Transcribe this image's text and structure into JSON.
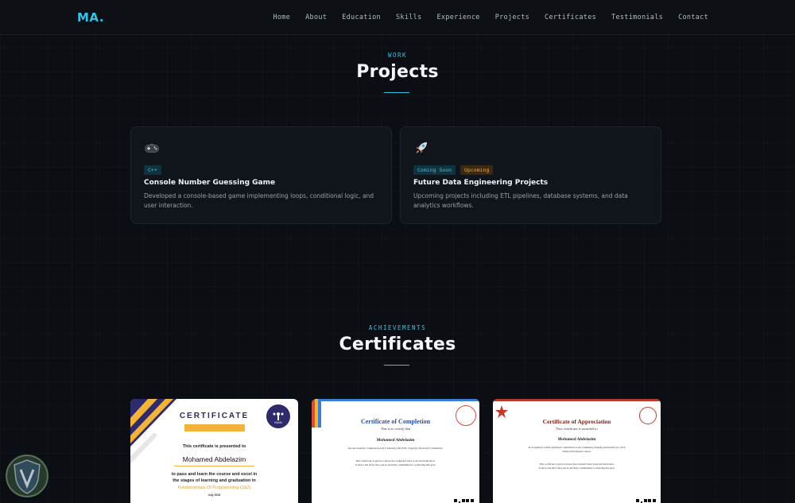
{
  "nav": {
    "logo": "MA.",
    "links": [
      "Home",
      "About",
      "Education",
      "Skills",
      "Experience",
      "Projects",
      "Certificates",
      "Testimonials",
      "Contact"
    ]
  },
  "projects_section": {
    "eyebrow": "WORK",
    "title": "Projects",
    "cards": [
      {
        "icon": "gamepad-icon",
        "tags": [
          "C++"
        ],
        "title": "Console Number Guessing Game",
        "description": "Developed a console-based game implementing loops, conditional logic, and user interaction."
      },
      {
        "icon": "rocket-icon",
        "tags": [
          "Coming Soon",
          "Upcoming"
        ],
        "title": "Future Data Engineering Projects",
        "description": "Upcoming projects including ETL pipelines, database systems, and data analytics workflows."
      }
    ]
  },
  "certificates_section": {
    "eyebrow": "ACHIEVEMENTS",
    "title": "Certificates",
    "certs": [
      {
        "heading": "CERTIFICATE",
        "presented": "This certificate is presented to",
        "name": "Mohamed Abdelazim",
        "line1": "to pass and learn the course and excel in",
        "line2": "the stages of learning and graduation in",
        "course": "Fundamentals Of Programming (1&2)",
        "date": "July 2024",
        "logo_text": "KIAN"
      },
      {
        "heading": "Certificate of Completion",
        "sub": "This is to certify that",
        "name": "Mohamed Abdelazim",
        "body1": "has successfully completed Level 0 training with ICPC Zagazig University Community.",
        "body2": "This certificate is given to honor the recipient's hard work and dedication.",
        "body3": "It shows the effort they put in and their commitment to achieving this goal."
      },
      {
        "heading": "Certificate of Appreciation",
        "sub": "This certificate is awarded to",
        "name": "Mohamed Abdelazim",
        "body1": "In recognition of their significant contribution to the community through participation in a Tech",
        "body2": "during 2024 Round Contest.",
        "body3": "This certificate is given to honor the recipient's hard work and dedication.",
        "body4": "It shows the effort they put in and their commitment to achieving this goal."
      }
    ]
  },
  "colors": {
    "accent": "#35c4e6",
    "background": "#0b0e13",
    "card": "#10141b",
    "amber": "#f0a64a"
  }
}
